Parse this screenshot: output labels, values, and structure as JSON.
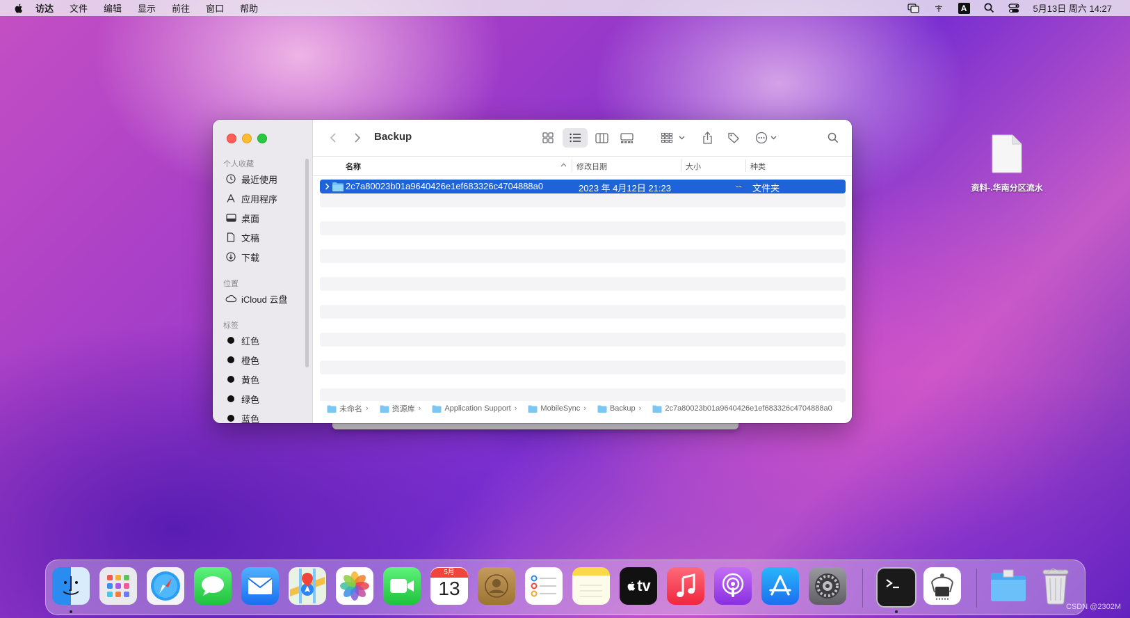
{
  "menubar": {
    "items": [
      "访达",
      "文件",
      "编辑",
      "显示",
      "前往",
      "窗口",
      "帮助"
    ],
    "input_badge": "A",
    "clock": "5月13日 周六  14:27"
  },
  "window": {
    "title": "Backup",
    "sidebar": {
      "favorites_title": "个人收藏",
      "favorites": [
        {
          "label": "最近使用",
          "icon": "clock-icon"
        },
        {
          "label": "应用程序",
          "icon": "applications-icon"
        },
        {
          "label": "桌面",
          "icon": "desktop-icon"
        },
        {
          "label": "文稿",
          "icon": "document-icon"
        },
        {
          "label": "下载",
          "icon": "download-icon"
        }
      ],
      "locations_title": "位置",
      "locations": [
        {
          "label": "iCloud 云盘",
          "icon": "icloud-icon"
        }
      ],
      "tags_title": "标签",
      "tags": [
        "红色",
        "橙色",
        "黄色",
        "绿色",
        "蓝色"
      ]
    },
    "columns": {
      "name": "名称",
      "modified": "修改日期",
      "size": "大小",
      "kind": "种类"
    },
    "rows": [
      {
        "name": "2c7a80023b01a9640426e1ef683326c4704888a0",
        "modified": "2023 年 4月12日 21:23",
        "size": "--",
        "kind": "文件夹"
      }
    ],
    "path": [
      "未命名",
      "资源库",
      "Application Support",
      "MobileSync",
      "Backup",
      "2c7a80023b01a9640426e1ef683326c4704888a0"
    ]
  },
  "desktop": {
    "file_label": "资料-.华南分区流水"
  },
  "dock": {
    "calendar_month": "5月",
    "calendar_day": "13",
    "tv_label": "tv"
  },
  "watermark": "CSDN @2302M",
  "colors": {
    "selection": "#1f63d9",
    "close": "#ff5f57",
    "minimize": "#febc2e",
    "zoom": "#28c840"
  }
}
